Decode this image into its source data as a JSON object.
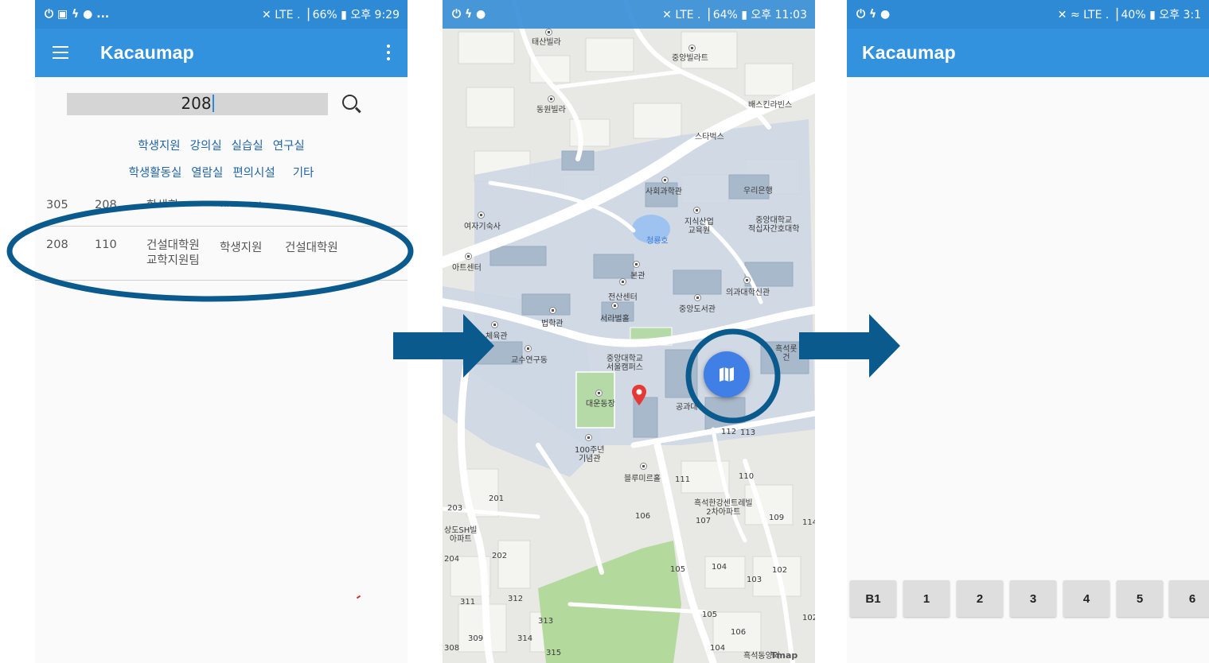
{
  "phone1": {
    "status": {
      "left_icons": "⏻ ▣ ϟ ● ...",
      "right": "✕ LTE .▕ 66% ▮ 오후 9:29"
    },
    "app_title": "Kacaumap",
    "search": {
      "value": "208"
    },
    "categories_row1": [
      "학생지원",
      "강의실",
      "실습실",
      "연구실"
    ],
    "categories_row2": [
      "학생활동실",
      "열람실",
      "편의시설",
      "기타"
    ],
    "row_partial": {
      "c1": "305",
      "c2": "208",
      "c3": "학생회",
      "c4": "학생지원"
    },
    "result_row": {
      "c1": "208",
      "c2": "110",
      "c3": "건설대학원\n교학지원팀",
      "c4": "학생지원",
      "c5": "건설대학원"
    }
  },
  "phone2": {
    "status": {
      "left_icons": "⏻ ϟ ●",
      "right": "✕ LTE .▕ 64% ▮ 오후 11:03"
    },
    "labels": {
      "l1": "태산빌라",
      "l2": "중앙빌라트",
      "l3": "동원빌라",
      "l4": "배스킨라빈스",
      "l5": "스타벅스",
      "l6": "사회과학관",
      "l7": "우리은행",
      "l8": "여자기숙사",
      "l9": "지식산업\n교육원",
      "l10": "중앙대학교\n적십자간호대학",
      "l11": "청룡호",
      "l12": "아트센터",
      "l13": "본관",
      "l14": "전산센터",
      "l15": "의과대학신관",
      "l16": "서라벌홀",
      "l17": "중앙도서관",
      "l18": "법학관",
      "l19": "체육관",
      "l20": "교수연구동",
      "l21": "중앙대학교\n서울캠퍼스",
      "l22": "대운동장",
      "l23": "공과대",
      "l24": "100주년\n기념관",
      "l25": "블루미르홀",
      "l26": "흑석한강센트레빌\n2차아파트",
      "l27": "상도SH빌\n아파트",
      "l28": "흑석롯\n건",
      "l29": "흑석동양외",
      "n112": "112",
      "n113": "113",
      "n111": "111",
      "n110": "110",
      "n106": "106",
      "n107": "107",
      "n109": "109",
      "n114": "114",
      "n105": "105",
      "n104": "104",
      "n103": "103",
      "n102": "102",
      "n201": "201",
      "n203": "203",
      "n202": "202",
      "n204": "204",
      "n311": "311",
      "n312": "312",
      "n313": "313",
      "n309": "309",
      "n314": "314",
      "n308": "308",
      "n315": "315",
      "n105b": "105",
      "n106b": "106",
      "n104b": "104",
      "n102b": "102"
    },
    "tmap_logo": "Tmap"
  },
  "phone3": {
    "status": {
      "left_icons": "⏻ ϟ ●",
      "right": "✕ ≈ LTE .▕ 40% ▮ 오후 3:1"
    },
    "app_title": "Kacaumap",
    "floors": [
      "B1",
      "1",
      "2",
      "3",
      "4",
      "5",
      "6"
    ]
  },
  "colors": {
    "appbar": "#3392dd",
    "arrow": "#0b5a8e",
    "fab": "#3f7fe6",
    "annotation": "#0b5a8e"
  }
}
